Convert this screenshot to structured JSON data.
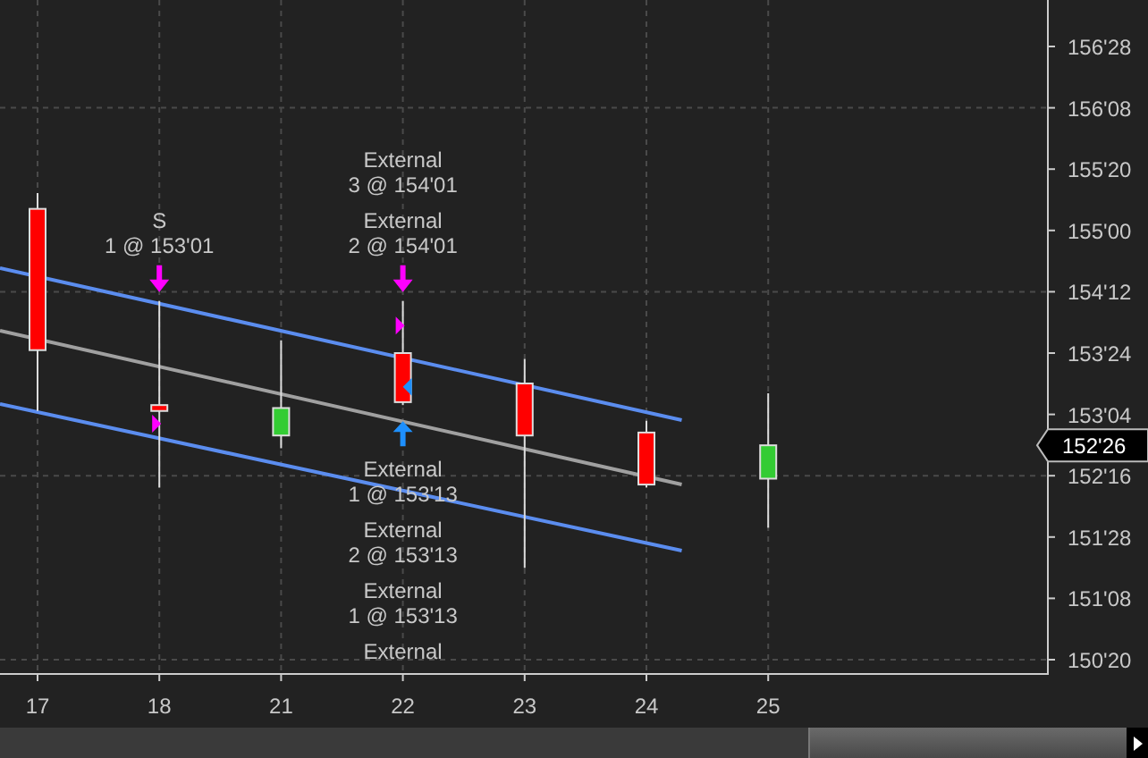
{
  "chart": {
    "price_axis": {
      "labels": [
        "156'28",
        "156'08",
        "155'20",
        "155'00",
        "154'12",
        "153'24",
        "153'04",
        "152'16",
        "151'28",
        "151'08",
        "150'20"
      ]
    },
    "date_axis": {
      "labels": [
        "17",
        "18",
        "21",
        "22",
        "23",
        "24",
        "25"
      ]
    },
    "trade_labels": [
      {
        "lines": [
          "S",
          "1 @ 153'01"
        ]
      },
      {
        "lines": [
          "External",
          "3 @ 154'01"
        ]
      },
      {
        "lines": [
          "External",
          "2 @ 154'01"
        ]
      },
      {
        "lines": [
          "External",
          "1 @ 153'13"
        ]
      },
      {
        "lines": [
          "External",
          "2 @ 153'13"
        ]
      },
      {
        "lines": [
          "External",
          "1 @ 153'13"
        ]
      },
      {
        "lines": [
          "External"
        ]
      }
    ],
    "last_price": "152'26"
  }
}
